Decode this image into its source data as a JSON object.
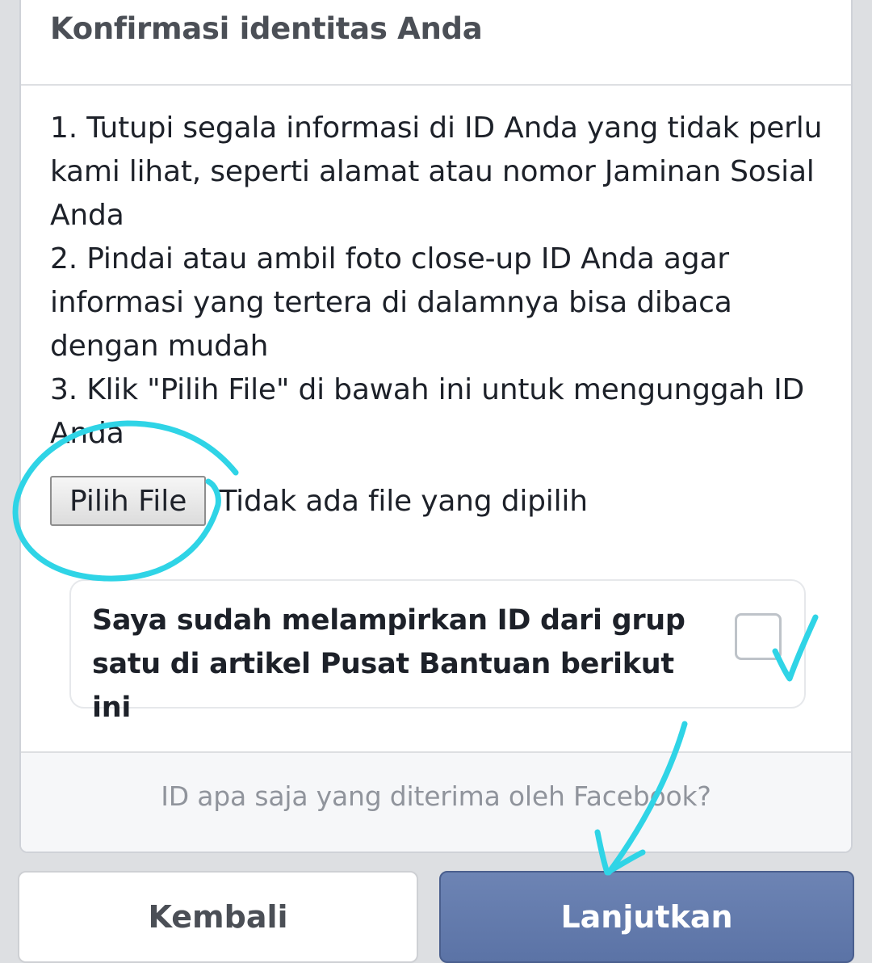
{
  "dialog": {
    "title": "Konfirmasi identitas Anda",
    "steps": [
      "1. Tutupi segala informasi di ID Anda yang tidak perlu kami lihat, seperti alamat atau nomor Jaminan Sosial Anda",
      "2. Pindai atau ambil foto close-up ID Anda agar informasi yang tertera di dalamnya bisa dibaca dengan mudah",
      "3. Klik \"Pilih File\" di bawah ini untuk mengunggah ID Anda"
    ],
    "file_button_label": "Pilih File",
    "file_status": "Tidak ada file yang dipilih",
    "confirm_text": "Saya sudah melampirkan ID dari grup satu di artikel Pusat Bantuan berikut ini",
    "confirm_checked": false,
    "help_link": "ID apa saja yang diterima oleh Facebook?"
  },
  "buttons": {
    "back_label": "Kembali",
    "next_label": "Lanjutkan"
  },
  "colors": {
    "page_background": "#dddfe2",
    "primary_button": "#5b73a6",
    "text_dark": "#1d2129",
    "text_muted": "#90949c",
    "annotation_ink": "#2fd4e6"
  }
}
